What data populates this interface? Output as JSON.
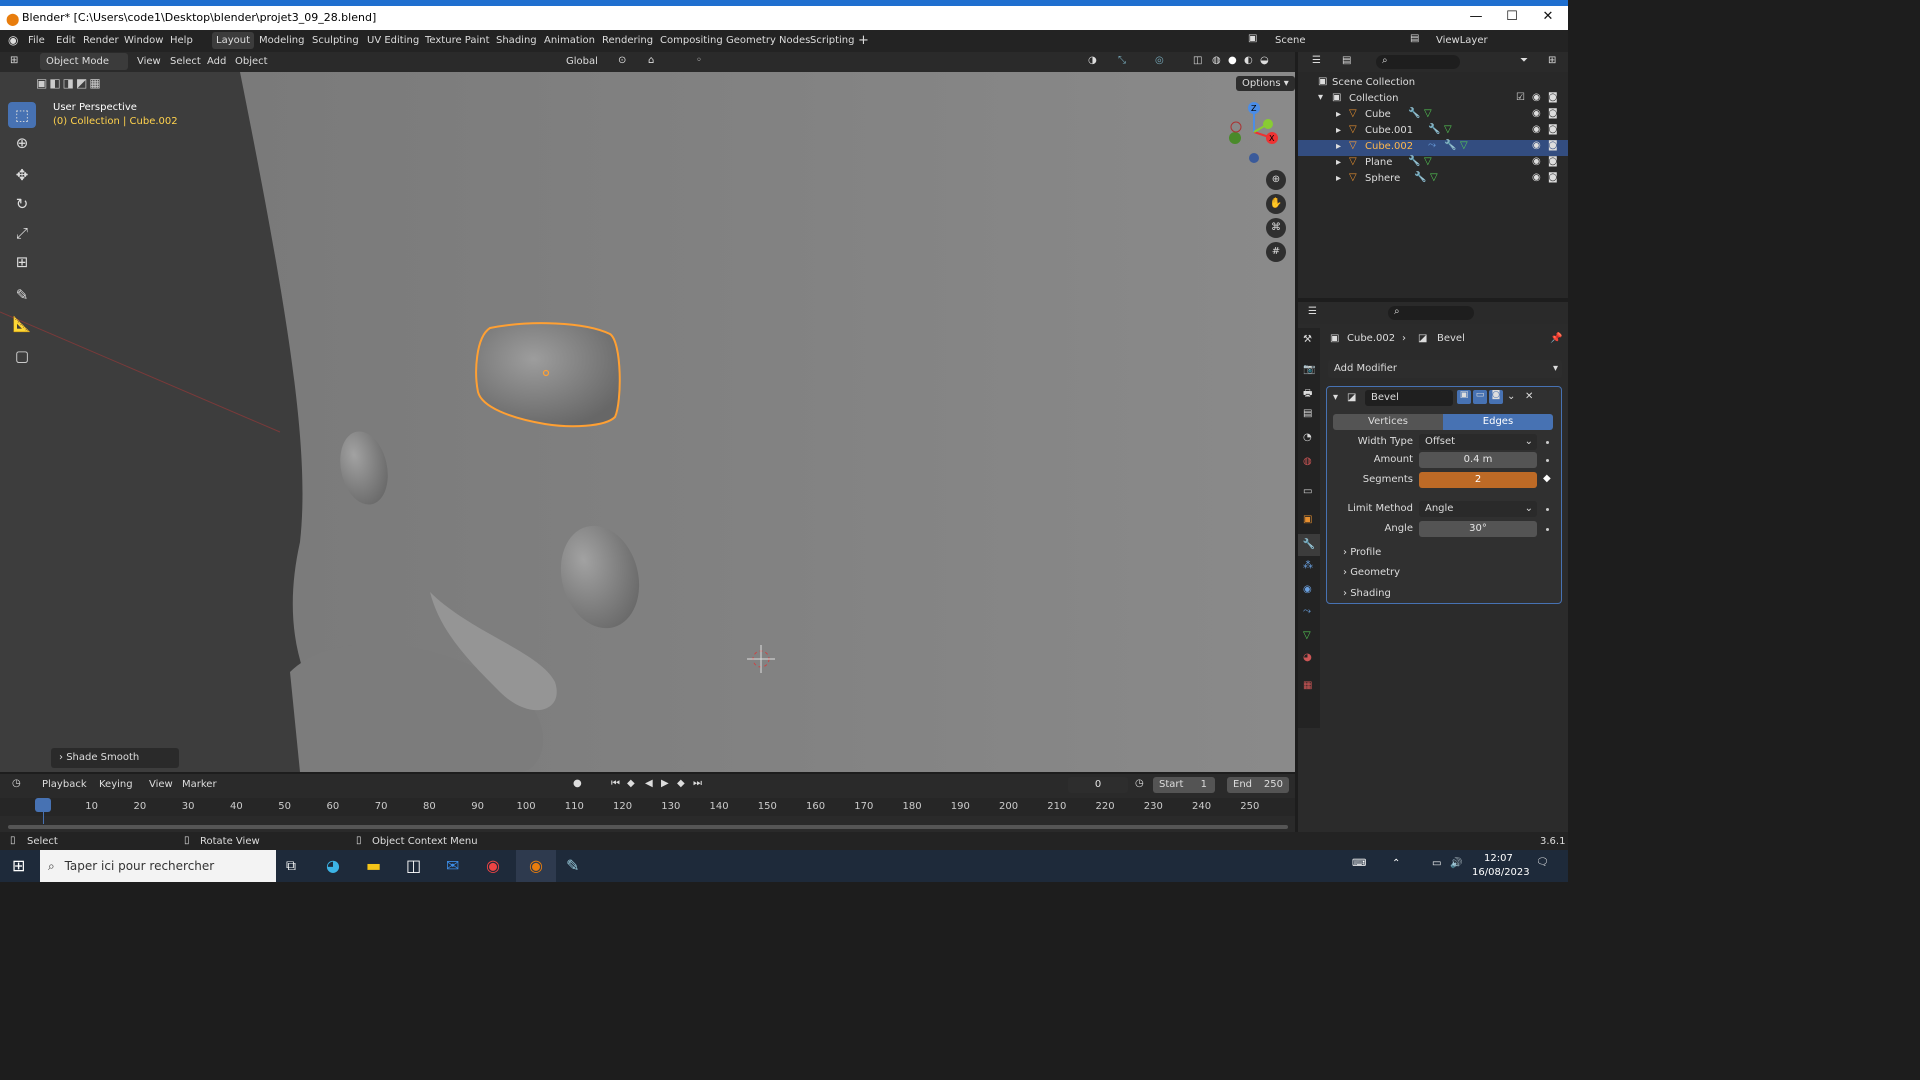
{
  "window": {
    "title": "Blender* [C:\\Users\\code1\\Desktop\\blender\\projet3_09_28.blend]"
  },
  "menu": {
    "file": "File",
    "edit": "Edit",
    "render": "Render",
    "window": "Window",
    "help": "Help"
  },
  "workspaces": [
    "Layout",
    "Modeling",
    "Sculpting",
    "UV Editing",
    "Texture Paint",
    "Shading",
    "Animation",
    "Rendering",
    "Compositing",
    "Geometry Nodes",
    "Scripting"
  ],
  "scene": "Scene",
  "viewlayer": "ViewLayer",
  "viewport_header": {
    "mode": "Object Mode",
    "view": "View",
    "select": "Select",
    "add": "Add",
    "object": "Object",
    "orientation": "Global",
    "options": "Options"
  },
  "viewport": {
    "perspective": "User Perspective",
    "collection_info": "(0) Collection | Cube.002",
    "last_op": "Shade Smooth"
  },
  "outliner": {
    "scene_collection": "Scene Collection",
    "collection": "Collection",
    "items": [
      "Cube",
      "Cube.001",
      "Cube.002",
      "Plane",
      "Sphere"
    ],
    "selected": "Cube.002"
  },
  "properties": {
    "breadcrumb_object": "Cube.002",
    "breadcrumb_modifier": "Bevel",
    "add_modifier": "Add Modifier",
    "modifier_name": "Bevel",
    "tab_vertices": "Vertices",
    "tab_edges": "Edges",
    "width_type_label": "Width Type",
    "width_type_value": "Offset",
    "amount_label": "Amount",
    "amount_value": "0.4 m",
    "segments_label": "Segments",
    "segments_value": "2",
    "limit_method_label": "Limit Method",
    "limit_method_value": "Angle",
    "angle_label": "Angle",
    "angle_value": "30°",
    "profile": "Profile",
    "geometry": "Geometry",
    "shading": "Shading"
  },
  "timeline": {
    "playback": "Playback",
    "keying": "Keying",
    "view": "View",
    "marker": "Marker",
    "current_frame": "0",
    "start_label": "Start",
    "start": "1",
    "end_label": "End",
    "end": "250",
    "ticks": [
      "0",
      "10",
      "20",
      "30",
      "40",
      "50",
      "60",
      "70",
      "80",
      "90",
      "100",
      "110",
      "120",
      "130",
      "140",
      "150",
      "160",
      "170",
      "180",
      "190",
      "200",
      "210",
      "220",
      "230",
      "240",
      "250"
    ]
  },
  "statusbar": {
    "select": "Select",
    "rotate": "Rotate View",
    "context": "Object Context Menu",
    "version": "3.6.1"
  },
  "taskbar": {
    "search_placeholder": "Taper ici pour rechercher",
    "time": "12:07",
    "date": "16/08/2023"
  },
  "colors": {
    "accent_blue": "#4772b3",
    "selection_orange": "#ffa033",
    "segments_orange": "#bd6a26"
  }
}
